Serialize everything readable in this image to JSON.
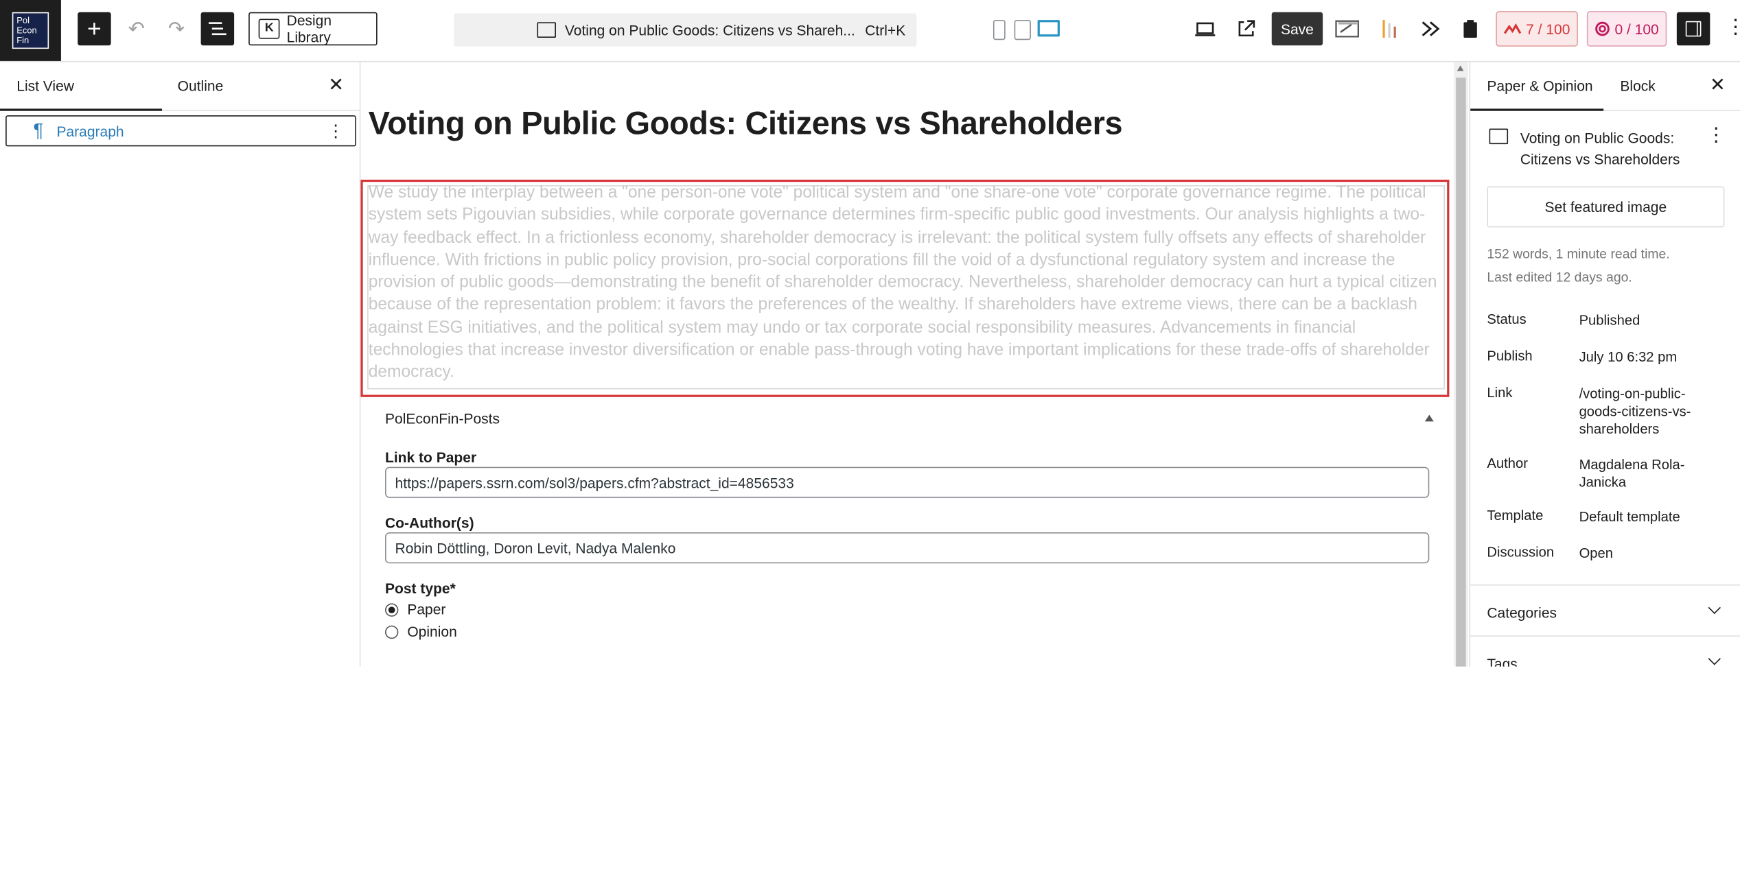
{
  "logo": {
    "text": [
      "Pol",
      "Econ",
      "Fin"
    ]
  },
  "toolbar": {
    "add_block_icon": "plus-icon",
    "undo_icon": "undo-icon",
    "redo_icon": "redo-icon",
    "design_library_label": "Design Library",
    "command_bar_title": "Voting on Public Goods: Citizens vs Shareh...",
    "command_bar_shortcut": "Ctrl+K",
    "save_label": "Save",
    "score_seo": "7 / 100",
    "score_readability": "0 / 100",
    "colors": {
      "seo_score": "#d63638",
      "readability_score": "#c2185b",
      "active_device": "#2a95c5"
    }
  },
  "left_panel": {
    "tabs": [
      "List View",
      "Outline"
    ],
    "items": [
      {
        "label": "Paragraph",
        "icon": "pilcrow-icon"
      }
    ]
  },
  "editor": {
    "title": "Voting on Public Goods: Citizens vs Shareholders",
    "abstract": "We study the interplay between a \"one person-one vote\" political system and \"one share-one vote\" corporate governance regime. The political system sets Pigouvian subsidies, while corporate governance determines firm-specific public good investments. Our analysis highlights a two-way feedback effect. In a frictionless economy, shareholder democracy is irrelevant: the political system fully offsets any effects of shareholder influence. With frictions in public policy provision, pro-social corporations fill the void of a dysfunctional regulatory system and increase the provision of public goods—demonstrating the benefit of shareholder democracy. Nevertheless, shareholder democracy can hurt a typical citizen because of the representation problem: it favors the preferences of the wealthy. If shareholders have extreme views, there can be a backlash against ESG initiatives, and the political system may undo or tax corporate social responsibility measures. Advancements in financial technologies that increase investor diversification or enable pass-through voting have important implications for these trade-offs of shareholder democracy.",
    "meta_box": {
      "title": "PolEconFin-Posts",
      "link_label": "Link to Paper",
      "link_value": "https://papers.ssrn.com/sol3/papers.cfm?abstract_id=4856533",
      "coauthors_label": "Co-Author(s)",
      "coauthors_value": "Robin Döttling, Doron Levit, Nadya Malenko",
      "post_type_label": "Post type*",
      "post_type_options": [
        "Paper",
        "Opinion"
      ],
      "post_type_selected": "Paper"
    }
  },
  "right_panel": {
    "tabs": [
      "Paper & Opinion",
      "Block"
    ],
    "doc_title": "Voting on Public Goods: Citizens vs Shareholders",
    "featured_image_label": "Set featured image",
    "stats_line1": "152 words, 1 minute read time.",
    "stats_line2": "Last edited 12 days ago.",
    "rows": [
      {
        "key": "Status",
        "value": "Published"
      },
      {
        "key": "Publish",
        "value": "July 10 6:32 pm"
      },
      {
        "key": "Link",
        "value": "/voting-on-public-goods-citizens-vs-shareholders"
      },
      {
        "key": "Author",
        "value": "Magdalena Rola-Janicka"
      },
      {
        "key": "Template",
        "value": "Default template"
      },
      {
        "key": "Discussion",
        "value": "Open"
      }
    ],
    "sections": [
      "Categories",
      "Tags"
    ]
  }
}
